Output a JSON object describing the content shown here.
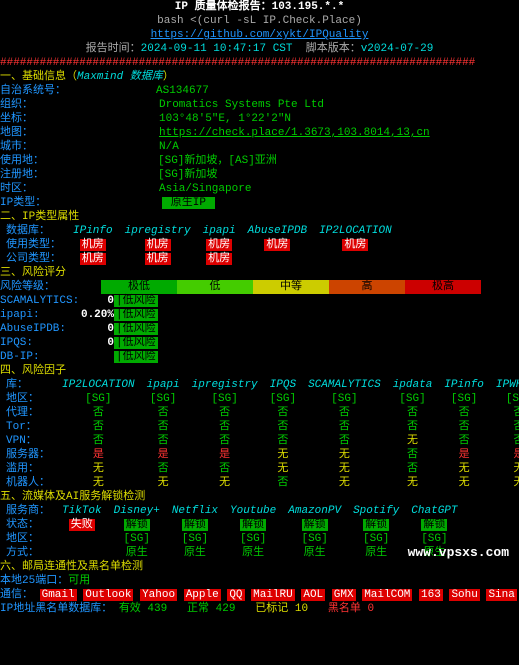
{
  "hdr": {
    "title": "IP 质量体检报告：",
    "ip": "103.195.*.*",
    "cmd": "bash <(curl -sL IP.Check.Place)",
    "url": "https://github.com/xykt/IPQuality",
    "rpt_time_l": "报告时间：",
    "rpt_time": "2024-09-11 10:47:17 CST",
    "ver_l": "脚本版本：",
    "ver": "v2024-07-29"
  },
  "hash": "########################################################################",
  "sec1": {
    "title": "一、基础信息（",
    "db": "Maxmind 数据库",
    "paren": "）",
    "asn_l": "自治系统号：",
    "asn": "AS134677",
    "org_l": "组织：",
    "org": "Dromatics Systems Pte Ltd",
    "coord_l": "坐标：",
    "coord": "103°48'5\"E, 1°22'2\"N",
    "map_l": "地图：",
    "map": "https://check.place/1.3673,103.8014,13,cn",
    "city_l": "城市：",
    "city": "N/A",
    "use_l": "使用地：",
    "use": "[SG]新加坡，[AS]亚洲",
    "reg_l": "注册地：",
    "reg": "[SG]新加坡",
    "tz_l": "时区：",
    "tz": "Asia/Singapore",
    "iptype_l": "IP类型：",
    "iptype": " 原生IP "
  },
  "sec2": {
    "title": "二、IP类型属性",
    "db_l": "数据库：",
    "use_l": "使用类型：",
    "comp_l": "公司类型：",
    "hdrs": [
      "IPinfo",
      "ipregistry",
      "ipapi",
      "AbuseIPDB",
      "IP2LOCATION"
    ],
    "use": [
      "机房",
      "机房",
      "机房",
      "机房",
      "机房"
    ],
    "comp": [
      "机房",
      "机房",
      "机房",
      "",
      ""
    ]
  },
  "sec3": {
    "title": "三、风险评分",
    "risk_l": "风险等级：",
    "bar": [
      "极低",
      "低",
      "中等",
      "高",
      "极高"
    ],
    "rows": [
      {
        "name": "SCAMALYTICS:",
        "val": "0",
        "txt": "|低风险"
      },
      {
        "name": "ipapi:",
        "val": "0.20%",
        "txt": "|低风险"
      },
      {
        "name": "AbuseIPDB:",
        "val": "0",
        "txt": "|低风险"
      },
      {
        "name": "IPQS:",
        "val": "0",
        "txt": "|低风险"
      },
      {
        "name": "DB-IP:",
        "val": "",
        "txt": "|低风险"
      }
    ]
  },
  "sec4": {
    "title": "四、风险因子",
    "db_l": "库：",
    "hdrs": [
      "IP2LOCATION",
      "ipapi",
      "ipregistry",
      "IPQS",
      "SCAMALYTICS",
      "ipdata",
      "IPinfo",
      "IPWHOIS"
    ],
    "rows": [
      {
        "l": "地区：",
        "v": [
          "[SG]",
          "[SG]",
          "[SG]",
          "[SG]",
          "[SG]",
          "[SG]",
          "[SG]",
          "[SG]"
        ],
        "c": [
          "grn",
          "grn",
          "grn",
          "grn",
          "grn",
          "grn",
          "grn",
          "grn"
        ]
      },
      {
        "l": "代理：",
        "v": [
          "否",
          "否",
          "否",
          "否",
          "否",
          "否",
          "否",
          "否"
        ],
        "c": [
          "grn",
          "grn",
          "grn",
          "grn",
          "grn",
          "grn",
          "grn",
          "grn"
        ]
      },
      {
        "l": "Tor：",
        "v": [
          "否",
          "否",
          "否",
          "否",
          "否",
          "否",
          "否",
          "否"
        ],
        "c": [
          "grn",
          "grn",
          "grn",
          "grn",
          "grn",
          "grn",
          "grn",
          "grn"
        ]
      },
      {
        "l": "VPN：",
        "v": [
          "否",
          "否",
          "否",
          "否",
          "否",
          "无",
          "否",
          "否"
        ],
        "c": [
          "grn",
          "grn",
          "grn",
          "grn",
          "grn",
          "ylw",
          "grn",
          "grn"
        ]
      },
      {
        "l": "服务器：",
        "v": [
          "是",
          "是",
          "是",
          "无",
          "无",
          "否",
          "是",
          "是"
        ],
        "c": [
          "red",
          "red",
          "red",
          "ylw",
          "ylw",
          "grn",
          "red",
          "red"
        ]
      },
      {
        "l": "滥用：",
        "v": [
          "无",
          "否",
          "否",
          "无",
          "无",
          "否",
          "无",
          "无"
        ],
        "c": [
          "ylw",
          "grn",
          "grn",
          "ylw",
          "ylw",
          "grn",
          "ylw",
          "ylw"
        ]
      },
      {
        "l": "机器人：",
        "v": [
          "无",
          "无",
          "无",
          "否",
          "无",
          "无",
          "无",
          "无"
        ],
        "c": [
          "ylw",
          "ylw",
          "ylw",
          "grn",
          "ylw",
          "ylw",
          "ylw",
          "ylw"
        ]
      }
    ]
  },
  "sec5": {
    "title": "五、流媒体及AI服务解锁检测",
    "svc_l": "服务商：",
    "svcs": [
      "TikTok",
      "Disney+",
      "Netflix",
      "Youtube",
      "AmazonPV",
      "Spotify",
      "ChatGPT"
    ],
    "stat_l": "状态：",
    "stat": [
      "失败",
      "解锁",
      "解锁",
      "解锁",
      "解锁",
      "解锁",
      "解锁"
    ],
    "stat_c": [
      "bg-red",
      "bg-grn",
      "bg-grn",
      "bg-grn",
      "bg-grn",
      "bg-grn",
      "bg-grn"
    ],
    "reg_l": "地区：",
    "reg": [
      "",
      "[SG]",
      "[SG]",
      "[SG]",
      "[SG]",
      "[SG]",
      "[SG]"
    ],
    "way_l": "方式：",
    "way": [
      "",
      "原生",
      "原生",
      "原生",
      "原生",
      "原生",
      "原生"
    ]
  },
  "sec6": {
    "title": "六、邮局连通性及黑名单检测",
    "port_l": "本地25端口：",
    "port": "可用",
    "comm_l": "通信：",
    "providers": [
      "Gmail",
      "Outlook",
      "Yahoo",
      "Apple",
      "QQ",
      "MailRU",
      "AOL",
      "GMX",
      "MailCOM",
      "163",
      "Sohu",
      "Sina"
    ],
    "bl_l": "IP地址黑名单数据库：",
    "ok_l": "有效",
    "ok": "439",
    "clean_l": "正常",
    "clean": "429",
    "mark_l": "已标记",
    "mark": "10",
    "bad_l": "黑名单",
    "bad": "0"
  },
  "watermark": "www.vpsxs.com"
}
